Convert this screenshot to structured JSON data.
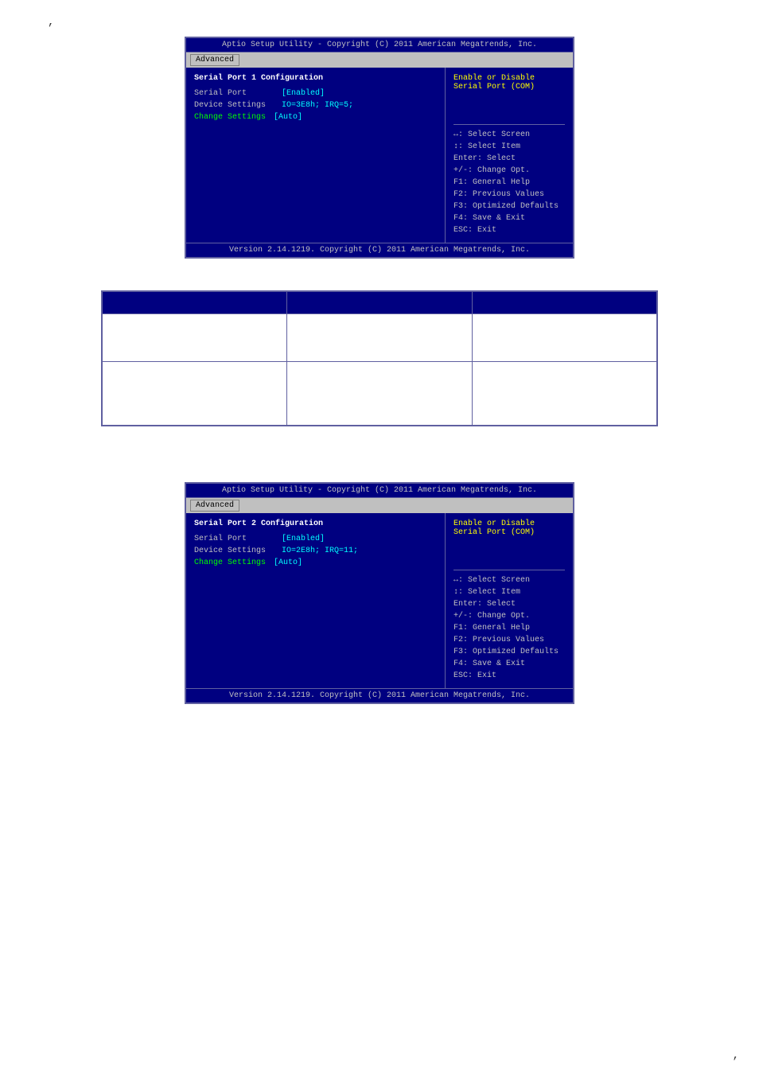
{
  "page": {
    "comma_top": ",",
    "comma_bottom": ","
  },
  "bios1": {
    "title": "Aptio Setup Utility - Copyright (C) 2011 American Megatrends, Inc.",
    "tab": "Advanced",
    "section_title": "Serial Port 1 Configuration",
    "rows": [
      {
        "label": "Serial Port",
        "value": "[Enabled]"
      },
      {
        "label": "Device Settings",
        "value": "IO=3E8h; IRQ=5;"
      },
      {
        "label": "",
        "value": ""
      },
      {
        "label": "Change Settings",
        "value": "[Auto]"
      }
    ],
    "help_text": "Enable or Disable Serial Port (COM)",
    "keys": [
      "↔: Select Screen",
      "↕: Select Item",
      "Enter: Select",
      "+/-: Change Opt.",
      "F1: General Help",
      "F2: Previous Values",
      "F3: Optimized Defaults",
      "F4: Save & Exit",
      "ESC: Exit"
    ],
    "footer": "Version 2.14.1219. Copyright (C) 2011 American Megatrends, Inc."
  },
  "table": {
    "headers": [
      "",
      "",
      ""
    ],
    "rows": [
      [
        "",
        "",
        ""
      ],
      [
        "",
        "",
        ""
      ]
    ]
  },
  "bios2": {
    "title": "Aptio Setup Utility - Copyright (C) 2011 American Megatrends, Inc.",
    "tab": "Advanced",
    "section_title": "Serial Port 2 Configuration",
    "rows": [
      {
        "label": "Serial Port",
        "value": "[Enabled]"
      },
      {
        "label": "Device Settings",
        "value": "IO=2E8h; IRQ=11;"
      },
      {
        "label": "",
        "value": ""
      },
      {
        "label": "Change Settings",
        "value": "[Auto]"
      }
    ],
    "help_text": "Enable or Disable Serial Port (COM)",
    "keys": [
      "↔: Select Screen",
      "↕: Select Item",
      "Enter: Select",
      "+/-: Change Opt.",
      "F1: General Help",
      "F2: Previous Values",
      "F3: Optimized Defaults",
      "F4: Save & Exit",
      "ESC: Exit"
    ],
    "footer": "Version 2.14.1219. Copyright (C) 2011 American Megatrends, Inc."
  }
}
